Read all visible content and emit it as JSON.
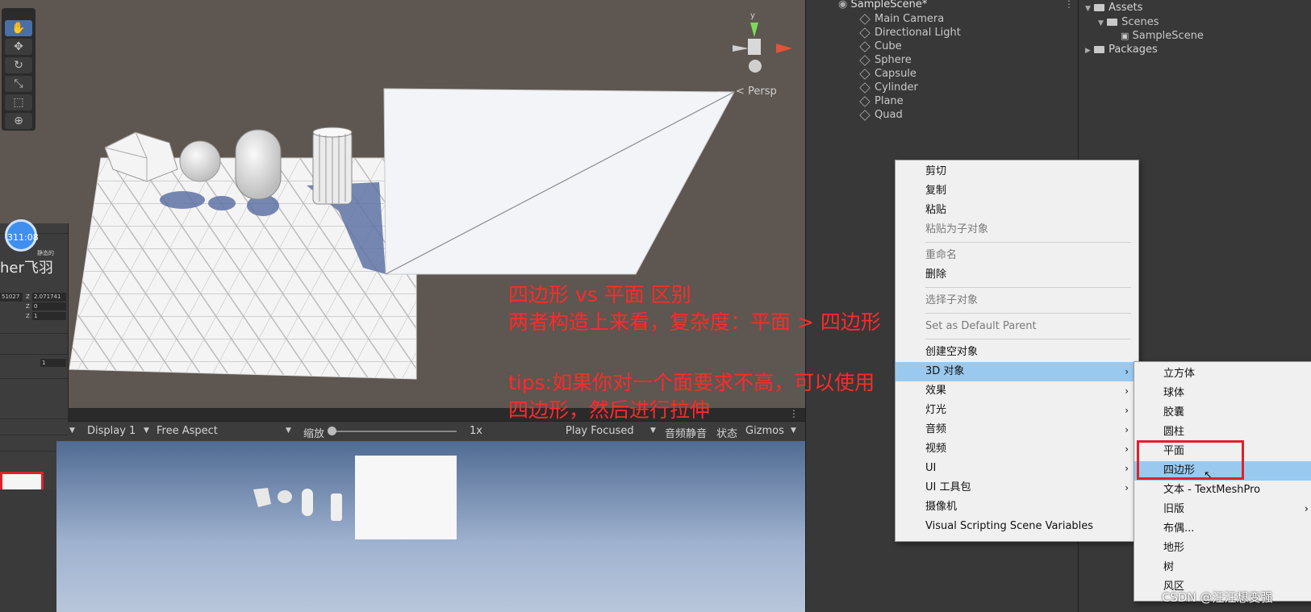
{
  "scene_view": {
    "persp_label": "< Persp",
    "gizmo_axis_label": "y",
    "tools": [
      "hand-tool",
      "move-tool",
      "rotate-tool",
      "scale-tool",
      "rect-tool",
      "transform-tool"
    ]
  },
  "inspector_fragment": {
    "badge": "311:08",
    "name_fragment": "her飞羽",
    "static_label": "静态的",
    "z1_label": "Z",
    "z1_value": "2.071741",
    "z2_label": "Z",
    "z2_value": "0",
    "z3_label": "Z",
    "z3_value": "1",
    "x_value": "51027",
    "extra_value": "1"
  },
  "game_toolbar": {
    "display": "Display 1",
    "aspect": "Free Aspect",
    "scale_label": "缩放",
    "scale_value": "1x",
    "play_mode": "Play Focused",
    "mute": "音频静音",
    "stats": "状态",
    "gizmos": "Gizmos"
  },
  "hierarchy": {
    "scene_name": "SampleScene*",
    "items": [
      "Main Camera",
      "Directional Light",
      "Cube",
      "Sphere",
      "Capsule",
      "Cylinder",
      "Plane",
      "Quad"
    ]
  },
  "project": {
    "assets": "Assets",
    "scenes": "Scenes",
    "sample_scene": "SampleScene",
    "packages": "Packages"
  },
  "context_menu": {
    "items": [
      {
        "label": "剪切",
        "enabled": true
      },
      {
        "label": "复制",
        "enabled": true
      },
      {
        "label": "粘贴",
        "enabled": true
      },
      {
        "label": "粘贴为子对象",
        "enabled": false
      },
      {
        "label": "重命名",
        "enabled": false
      },
      {
        "label": "删除",
        "enabled": true
      },
      {
        "label": "选择子对象",
        "enabled": false
      },
      {
        "label": "Set as Default Parent",
        "enabled": false
      },
      {
        "label": "创建空对象",
        "enabled": true
      },
      {
        "label": "3D 对象",
        "enabled": true,
        "submenu": true,
        "highlighted": true
      },
      {
        "label": "效果",
        "submenu": true
      },
      {
        "label": "灯光",
        "submenu": true
      },
      {
        "label": "音频",
        "submenu": true
      },
      {
        "label": "视频",
        "submenu": true
      },
      {
        "label": "UI",
        "submenu": true
      },
      {
        "label": "UI 工具包",
        "submenu": true
      },
      {
        "label": "摄像机"
      },
      {
        "label": "Visual Scripting Scene Variables"
      }
    ]
  },
  "submenu_3d": {
    "items": [
      {
        "label": "立方体"
      },
      {
        "label": "球体"
      },
      {
        "label": "胶囊"
      },
      {
        "label": "圆柱"
      },
      {
        "label": "平面"
      },
      {
        "label": "四边形",
        "highlighted": true
      },
      {
        "label": "文本 - TextMeshPro"
      },
      {
        "label": "旧版",
        "submenu": true
      },
      {
        "label": "布偶..."
      },
      {
        "label": "地形"
      },
      {
        "label": "树"
      },
      {
        "label": "风区"
      }
    ]
  },
  "annotation": {
    "line1": "四边形 vs 平面 区别",
    "line2": "两者构造上来看，复杂度：平面 > 四边形",
    "line3": "tips:如果你对一个面要求不高，可以使用",
    "line4": "四边形，然后进行拉伸"
  },
  "watermark": "CSDN @汪汪想变强",
  "colors": {
    "annotation_red": "#ff2a2a",
    "menu_highlight": "#99c9ef",
    "scene_bg": "#5e5650"
  }
}
